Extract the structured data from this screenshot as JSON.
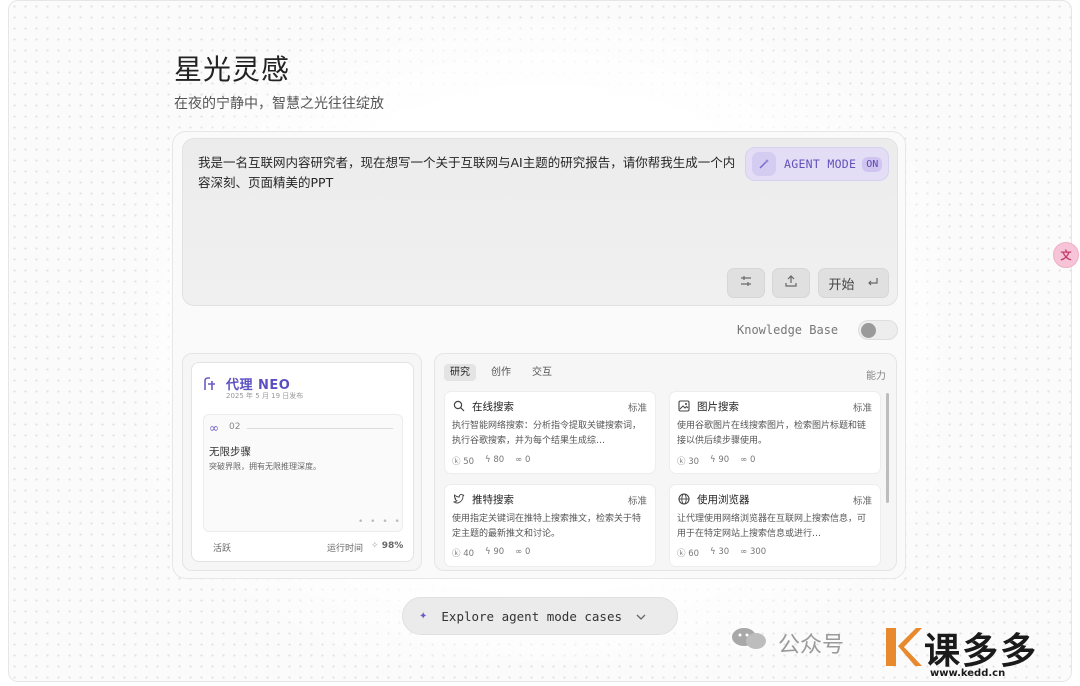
{
  "page": {
    "title": "星光灵感",
    "subtitle": "在夜的宁静中，智慧之光往往绽放"
  },
  "prompt": {
    "text": "我是一名互联网内容研究者，现在想写一个关于互联网与AI主题的研究报告，请你帮我生成一个内容深刻、页面精美的PPT",
    "agent_mode_label": "AGENT MODE",
    "agent_mode_state": "ON",
    "start_label": "开始",
    "settings_icon": "sliders-icon",
    "upload_icon": "upload-icon",
    "enter_icon": "enter-icon"
  },
  "knowledge_base": {
    "label": "Knowledge Base",
    "enabled": false
  },
  "agent_card": {
    "name": "代理 NEO",
    "date": "2025 年 5 月 19 日发布",
    "step_number": "02",
    "step_title": "无限步骤",
    "step_desc": "突破界限，拥有无限推理深度。",
    "active_label": "活跃",
    "runtime_label": "运行时间",
    "runtime_value": "98%"
  },
  "tools_panel": {
    "tabs": [
      "研究",
      "创作",
      "交互"
    ],
    "active_tab": "研究",
    "ability_label": "能力",
    "tools": [
      {
        "icon": "search-icon",
        "name": "在线搜索",
        "tag": "标准",
        "desc": "执行智能网络搜索：分析指令提取关键搜索词，执行谷歌搜索，并为每个结果生成综…",
        "stats": [
          "50",
          "80",
          "0"
        ]
      },
      {
        "icon": "image-icon",
        "name": "图片搜索",
        "tag": "标准",
        "desc": "使用谷歌图片在线搜索图片，检索图片标题和链接以供后续步骤使用。",
        "stats": [
          "30",
          "90",
          "0"
        ]
      },
      {
        "icon": "twitter-icon",
        "name": "推特搜索",
        "tag": "标准",
        "desc": "使用指定关键词在推特上搜索推文，检索关于特定主题的最新推文和讨论。",
        "stats": [
          "40",
          "90",
          "0"
        ]
      },
      {
        "icon": "globe-icon",
        "name": "使用浏览器",
        "tag": "标准",
        "desc": "让代理使用网络浏览器在互联网上搜索信息，可用于在特定网站上搜索信息或进行…",
        "stats": [
          "60",
          "30",
          "300"
        ]
      }
    ]
  },
  "explore": {
    "label": "Explore agent mode cases"
  },
  "watermark": {
    "gzh": "公众号",
    "brand": "课多多",
    "url": "www.kedd.cn"
  },
  "colors": {
    "accent": "#6c5cc4",
    "agent_pill_bg": "#e3ddf6",
    "translate_fab": "#f6c4d6"
  }
}
